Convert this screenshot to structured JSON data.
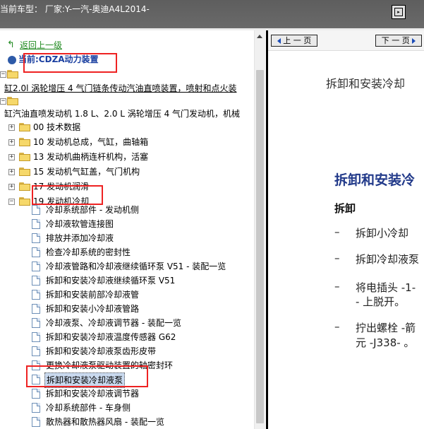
{
  "header": {
    "title": "当前车型：  厂家:Y-一汽-奥迪A4L2014-"
  },
  "tree": {
    "back_label": "返回上一级",
    "current_label": "当前:CDZA动力装置",
    "engine_long": "缸2.0l 涡轮增压 4 气门链条传动汽油直喷装置，喷射和点火装",
    "engine_group": "缸汽油直喷发动机 1.8 L、2.0 L 涡轮增压 4 气门发动机，机械",
    "folders": [
      "00 技术数据",
      "10 发动机总成，气缸，曲轴箱",
      "13 发动机曲柄连杆机构，活塞",
      "15 发动机气缸盖，气门机构",
      "17 发动机润滑",
      "19 发动机冷却"
    ],
    "docs": [
      "冷却系统部件 - 发动机侧",
      "冷却液软管连接图",
      "排放并添加冷却液",
      "检查冷却系统的密封性",
      "冷却液管路和冷却液继续循环泵 V51 - 装配一览",
      "拆卸和安装冷却液继续循环泵 V51",
      "拆卸和安装前部冷却液管",
      "拆卸和安装小冷却液管路",
      "冷却液泵、冷却液调节器 - 装配一览",
      "拆卸和安装冷却液温度传感器 G62",
      "拆卸和安装冷却液泵齿形皮带",
      "更换冷却液泵驱动装置的轴密封环",
      "拆卸和安装冷却液泵",
      "拆卸和安装冷却液调节器",
      "冷却系统部件 - 车身侧",
      "散热器和散热器风扇 - 装配一览"
    ]
  },
  "viewer": {
    "prev_label": "上 一 页",
    "next_label": "下 一 页",
    "page_title": "拆卸和安装冷却",
    "heading": "拆卸和安装冷",
    "subheading": "拆卸",
    "steps": [
      {
        "dash": "–",
        "text": "拆卸小冷却"
      },
      {
        "dash": "–",
        "text": "拆卸冷却液泵"
      },
      {
        "dash": "–",
        "text": "将电插头 -1-",
        "cont": "- 上脱开。"
      },
      {
        "dash": "–",
        "text": "拧出螺栓 -箭",
        "cont": "元 -J338- 。"
      }
    ]
  },
  "colors": {
    "titlebar": "#626262",
    "highlight": "#e22222",
    "heading": "#223a8a",
    "link_green": "#228b22"
  }
}
